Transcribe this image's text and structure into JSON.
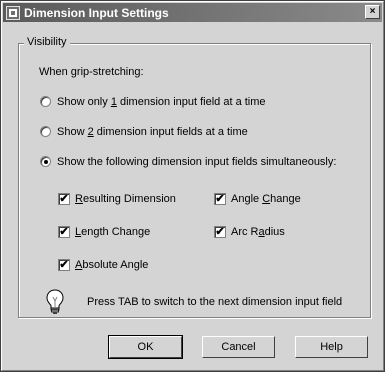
{
  "window": {
    "title": "Dimension Input Settings",
    "close_label": "×"
  },
  "group": {
    "legend": "Visibility",
    "subtitle": "When grip-stretching:"
  },
  "radios": [
    {
      "before": "Show only ",
      "accel": "1",
      "after": " dimension input field at a time",
      "checked": false
    },
    {
      "before": "Show ",
      "accel": "2",
      "after": " dimension input fields at a time",
      "checked": false
    },
    {
      "before": "Show the following dimension input fields simultaneously:",
      "accel": "",
      "after": "",
      "checked": true
    }
  ],
  "checkboxes": {
    "resulting_dimension": {
      "accel": "R",
      "rest": "esulting Dimension",
      "checked": true
    },
    "angle_change": {
      "before": "Angle ",
      "accel": "C",
      "rest": "hange",
      "checked": true
    },
    "length_change": {
      "accel": "L",
      "rest": "ength Change",
      "checked": true
    },
    "arc_radius": {
      "before": "Arc R",
      "accel": "a",
      "rest": "dius",
      "checked": true
    },
    "absolute_angle": {
      "accel": "A",
      "rest": "bsolute Angle",
      "checked": true
    }
  },
  "tip": {
    "icon": "lightbulb-icon",
    "text": "Press TAB to switch to the next dimension input field"
  },
  "buttons": {
    "ok": "OK",
    "cancel": "Cancel",
    "help": "Help"
  },
  "checkmark": "✔"
}
